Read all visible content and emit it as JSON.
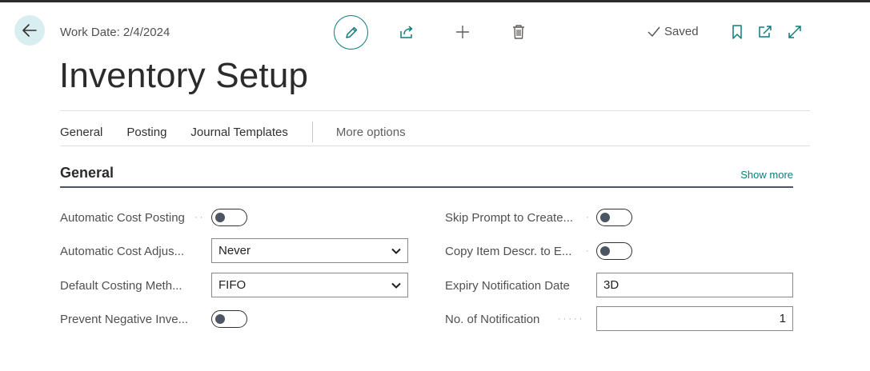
{
  "header": {
    "work_date": "Work Date: 2/4/2024",
    "saved_label": "Saved"
  },
  "page": {
    "title": "Inventory Setup"
  },
  "tabs": [
    {
      "label": "General"
    },
    {
      "label": "Posting"
    },
    {
      "label": "Journal Templates"
    }
  ],
  "more_options": "More options",
  "section": {
    "title": "General",
    "show_more": "Show more"
  },
  "fields_left": [
    {
      "label": "Automatic Cost Posting",
      "type": "toggle",
      "value": false
    },
    {
      "label": "Automatic Cost Adjus...",
      "type": "select",
      "value": "Never"
    },
    {
      "label": "Default Costing Meth...",
      "type": "select",
      "value": "FIFO"
    },
    {
      "label": "Prevent Negative Inve...",
      "type": "toggle",
      "value": false
    }
  ],
  "fields_right": [
    {
      "label": "Skip Prompt to Create...",
      "type": "toggle",
      "value": false
    },
    {
      "label": "Copy Item Descr. to E...",
      "type": "toggle",
      "value": false
    },
    {
      "label": "Expiry Notification Date",
      "type": "text",
      "value": "3D"
    },
    {
      "label": "No. of Notification",
      "type": "number",
      "value": "1"
    }
  ],
  "colors": {
    "accent": "#0f7b7b",
    "back_button_bg": "#d8eef0",
    "toggle_knob": "#4b5563"
  },
  "icons": {
    "back": "arrow-left-icon",
    "edit": "pencil-icon",
    "share": "share-icon",
    "new": "plus-icon",
    "delete": "trash-icon",
    "saved": "checkmark-icon",
    "bookmark": "bookmark-icon",
    "popout": "open-in-new-window-icon",
    "expand": "expand-icon",
    "dropdown": "chevron-down-icon"
  }
}
